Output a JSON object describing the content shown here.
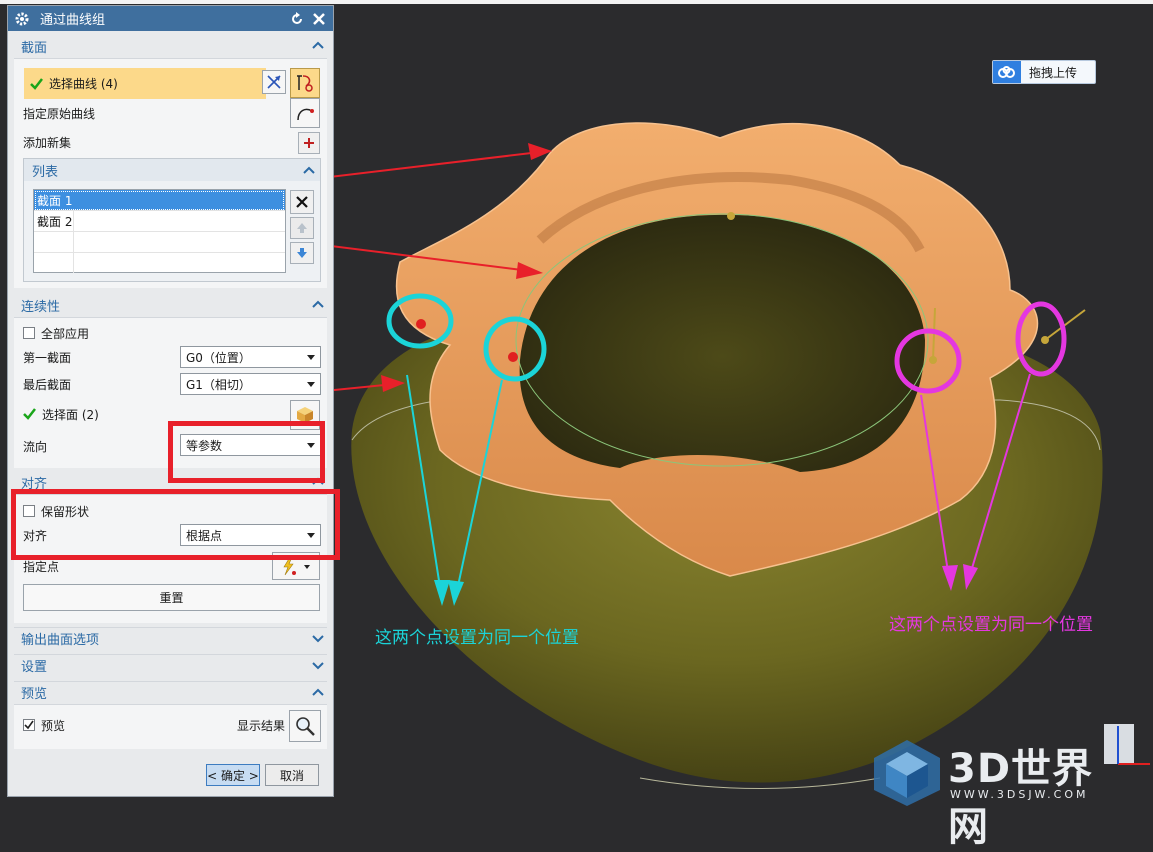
{
  "dialog": {
    "title": "通过曲线组",
    "section": {
      "title": "截面",
      "select_curve": "选择曲线 (4)",
      "specify_origin": "指定原始曲线",
      "add_new_set": "添加新集",
      "list": {
        "title": "列表",
        "rows": [
          "截面 1",
          "截面 2"
        ]
      }
    },
    "continuity": {
      "title": "连续性",
      "apply_all": "全部应用",
      "first_section_label": "第一截面",
      "first_section_value": "G0（位置）",
      "last_section_label": "最后截面",
      "last_section_value": "G1（相切）",
      "select_face": "选择面 (2)",
      "flow_dir_label": "流向",
      "flow_dir_value": "等参数"
    },
    "alignment": {
      "title": "对齐",
      "keep_shape": "保留形状",
      "align_label": "对齐",
      "align_value": "根据点",
      "specify_point": "指定点",
      "reset": "重置"
    },
    "output_options": "输出曲面选项",
    "settings": "设置",
    "preview": {
      "title": "预览",
      "preview_label": "预览",
      "show_result": "显示结果"
    },
    "ok": "< 确定 >",
    "cancel": "取消"
  },
  "viewport": {
    "upload_button": "拖拽上传",
    "annotation_left": "这两个点设置为同一个位置",
    "annotation_right": "这两个点设置为同一个位置"
  },
  "watermark": {
    "title": "3D世界网",
    "url": "WWW.3DSJW.COM"
  },
  "colors": {
    "accent_blue": "#2b6aa5",
    "annotation_red": "#e8202a",
    "annotation_cyan": "#1bd4d8",
    "annotation_magenta": "#e437e0",
    "surface_orange": "#e89a58",
    "body_olive": "#6e6a22"
  }
}
